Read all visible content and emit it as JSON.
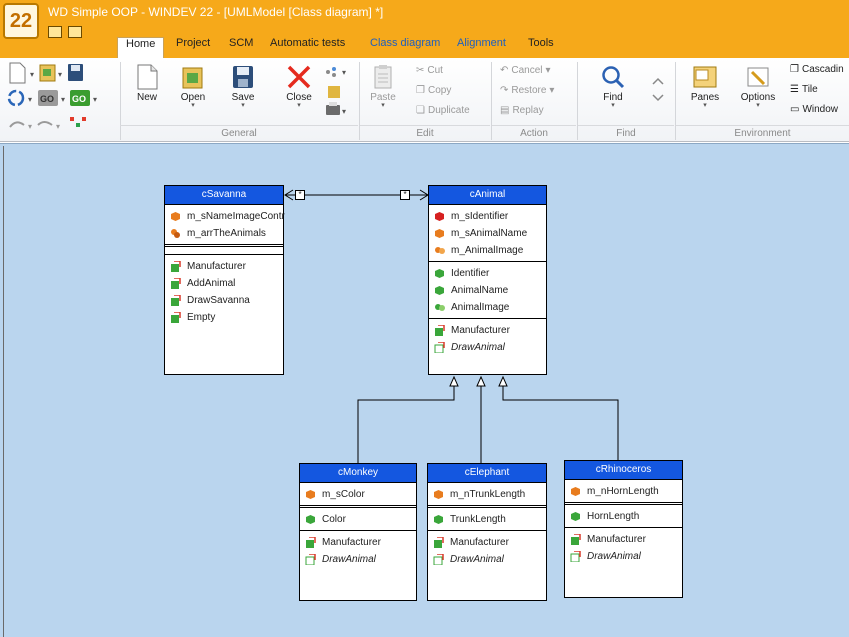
{
  "window": {
    "title": "WD Simple OOP - WINDEV 22 - [UMLModel [Class diagram] *]",
    "logo_text": "22"
  },
  "tabs": [
    {
      "label": "Home",
      "active": true
    },
    {
      "label": "Project"
    },
    {
      "label": "SCM"
    },
    {
      "label": "Automatic tests"
    },
    {
      "label": "Class diagram",
      "contextual": true
    },
    {
      "label": "Alignment",
      "contextual": true
    },
    {
      "label": "Tools"
    }
  ],
  "ribbon": {
    "general": {
      "group_label": "General",
      "new": "New",
      "open": "Open",
      "save": "Save",
      "close": "Close"
    },
    "edit": {
      "group_label": "Edit",
      "paste": "Paste",
      "cut": "Cut",
      "copy": "Copy",
      "duplicate": "Duplicate"
    },
    "action": {
      "group_label": "Action",
      "cancel": "Cancel",
      "restore": "Restore",
      "replay": "Replay"
    },
    "find": {
      "group_label": "Find",
      "find": "Find"
    },
    "environment": {
      "group_label": "Environment",
      "panes": "Panes",
      "options": "Options",
      "cascading": "Cascadin",
      "tile": "Tile",
      "window": "Window"
    }
  },
  "diagram": {
    "multiplicity_marker": "*",
    "classes": {
      "savanna": {
        "name": "cSavanna",
        "members": [
          "m_sNameImageContr",
          "m_arrTheAnimals"
        ],
        "methods": [
          "Manufacturer",
          "AddAnimal",
          "DrawSavanna",
          "Empty"
        ]
      },
      "animal": {
        "name": "cAnimal",
        "members": [
          "m_sIdentifier",
          "m_sAnimalName",
          "m_AnimalImage"
        ],
        "properties": [
          "Identifier",
          "AnimalName",
          "AnimalImage"
        ],
        "methods": [
          "Manufacturer",
          "DrawAnimal"
        ]
      },
      "monkey": {
        "name": "cMonkey",
        "members": [
          "m_sColor"
        ],
        "properties": [
          "Color"
        ],
        "methods": [
          "Manufacturer",
          "DrawAnimal"
        ]
      },
      "elephant": {
        "name": "cElephant",
        "members": [
          "m_nTrunkLength"
        ],
        "properties": [
          "TrunkLength"
        ],
        "methods": [
          "Manufacturer",
          "DrawAnimal"
        ]
      },
      "rhinoceros": {
        "name": "cRhinoceros",
        "members": [
          "m_nHornLength"
        ],
        "properties": [
          "HornLength"
        ],
        "methods": [
          "Manufacturer",
          "DrawAnimal"
        ]
      }
    }
  },
  "colors": {
    "title_bar": "#f6a91a",
    "canvas": "#bad5ee",
    "class_header": "#1457e0"
  }
}
